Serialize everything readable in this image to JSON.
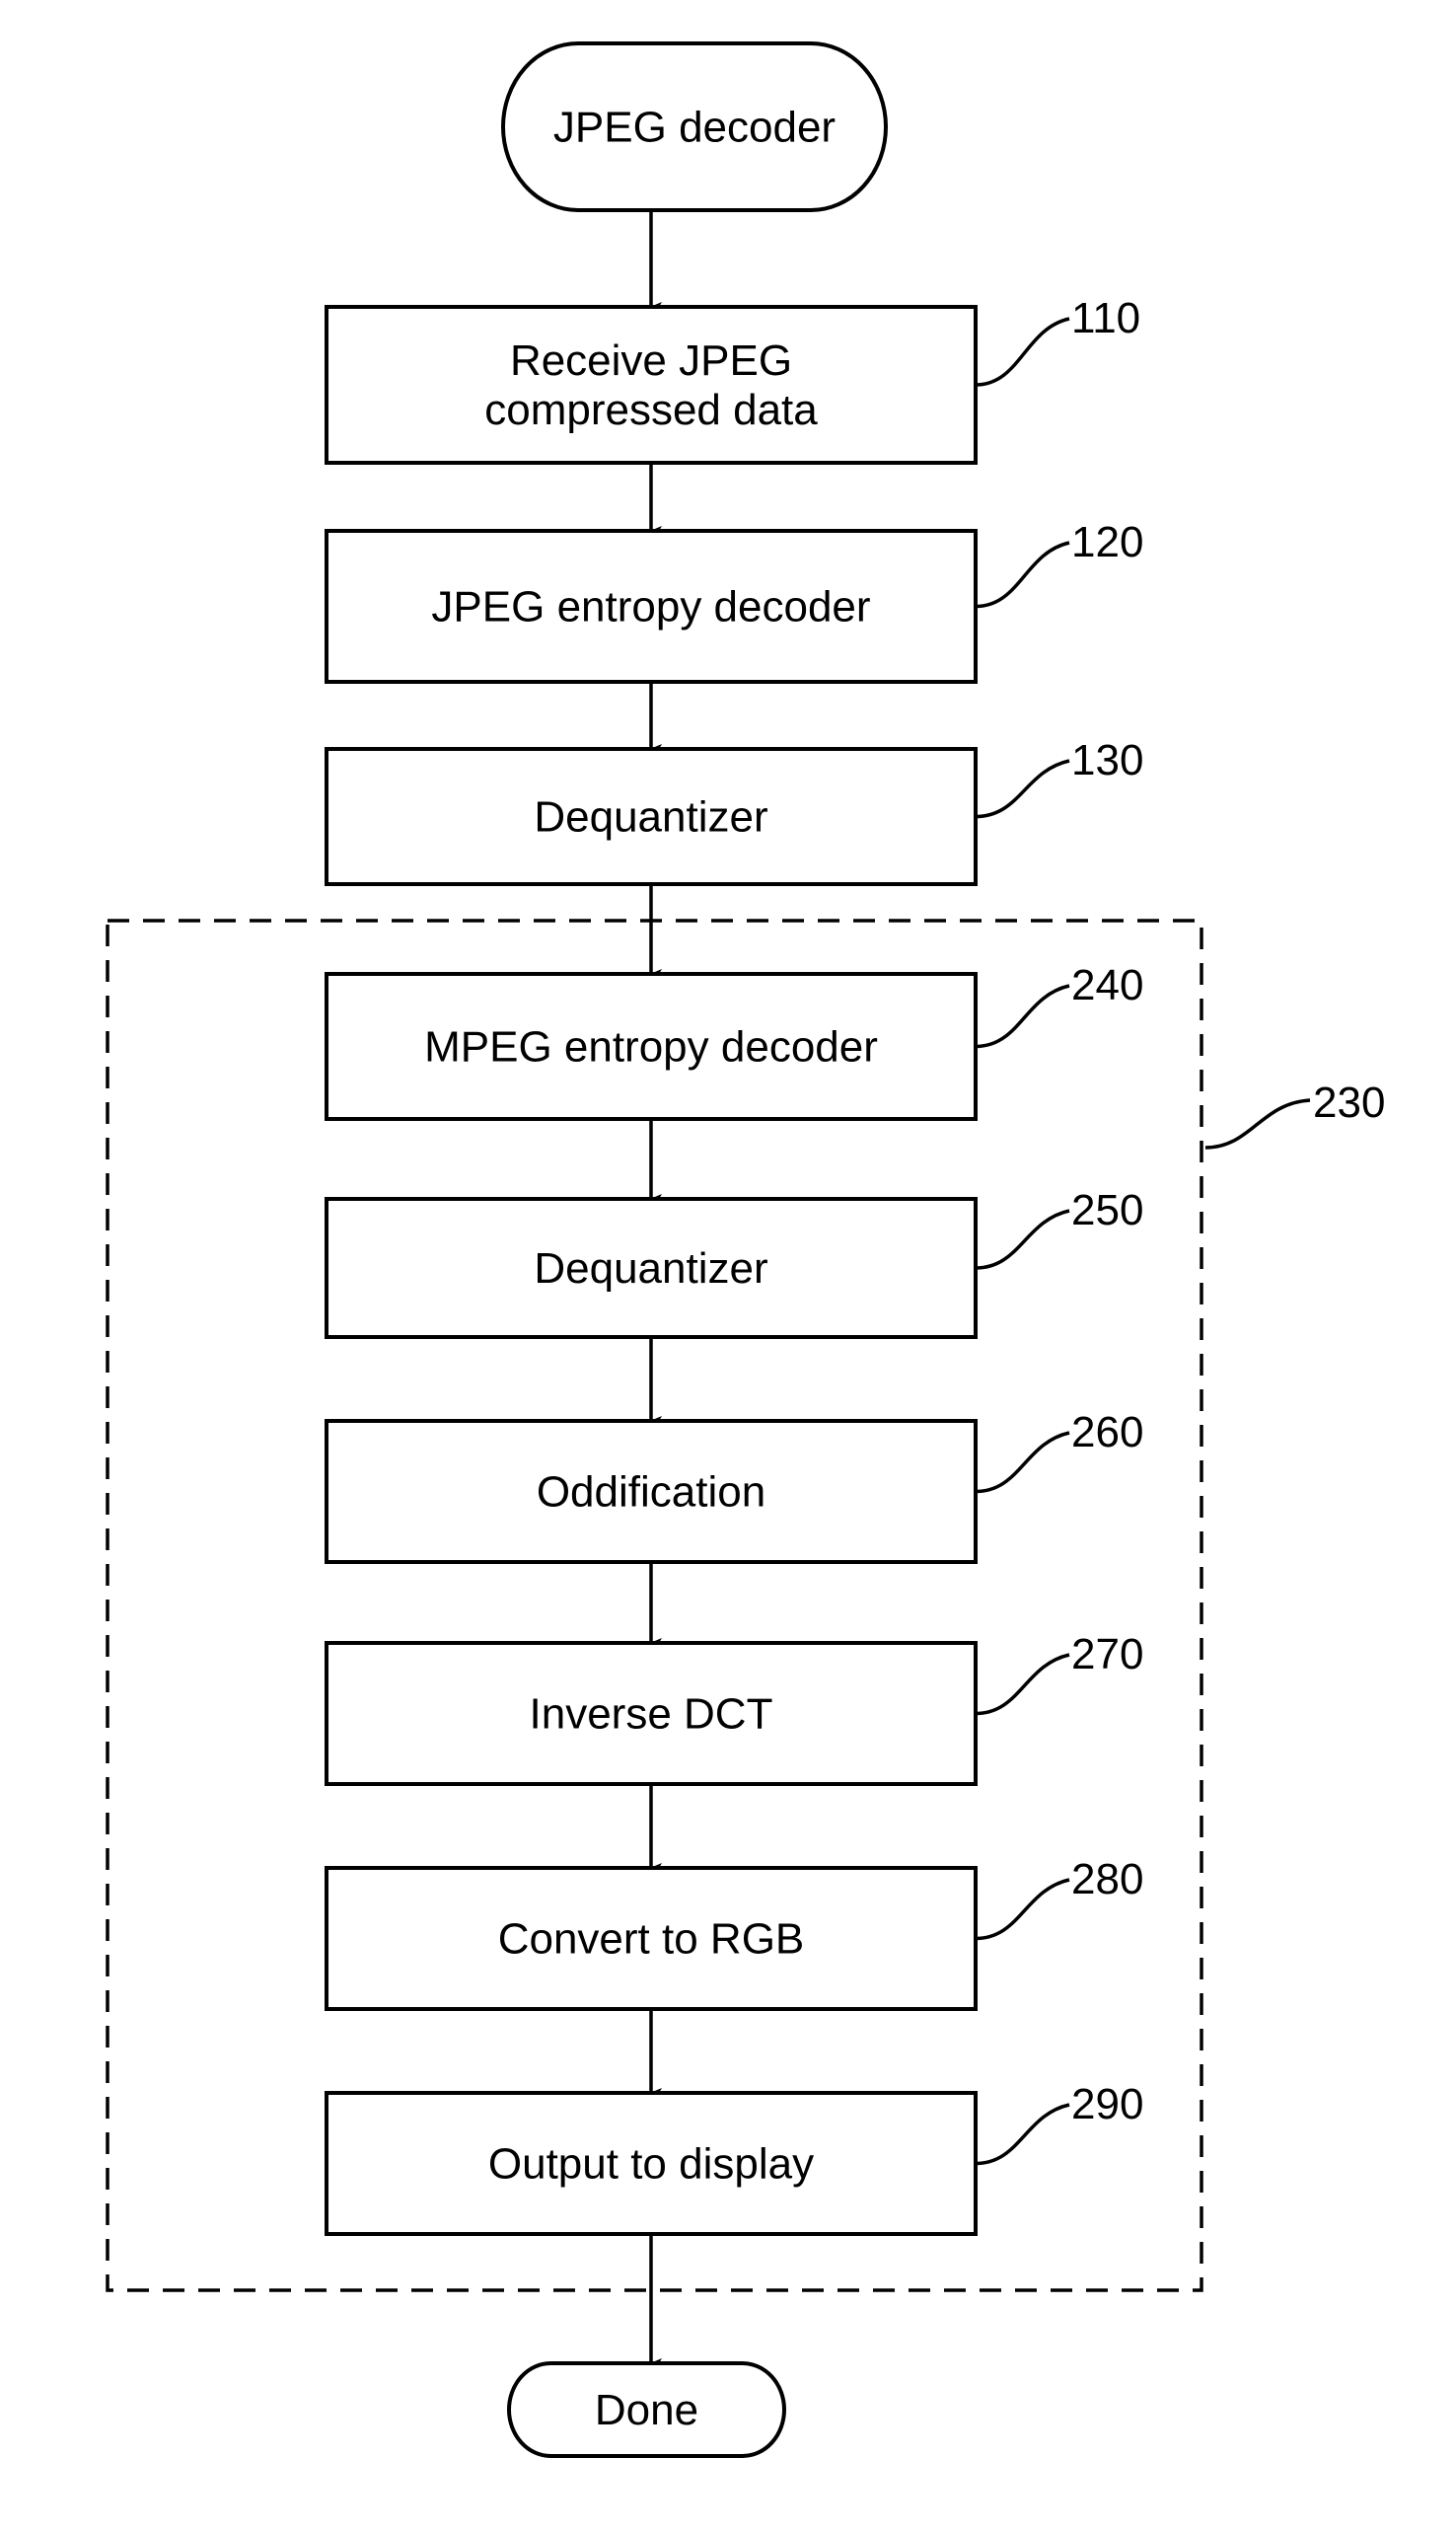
{
  "diagram": {
    "type": "flowchart",
    "start": {
      "label": "JPEG decoder"
    },
    "end": {
      "label": "Done"
    },
    "steps": [
      {
        "id": "110",
        "label": [
          "Receive JPEG",
          "compressed data"
        ],
        "ref": "110"
      },
      {
        "id": "120",
        "label": [
          "JPEG entropy decoder"
        ],
        "ref": "120"
      },
      {
        "id": "130",
        "label": [
          "Dequantizer"
        ],
        "ref": "130"
      },
      {
        "id": "240",
        "label": [
          "MPEG entropy decoder"
        ],
        "ref": "240"
      },
      {
        "id": "250",
        "label": [
          "Dequantizer"
        ],
        "ref": "250"
      },
      {
        "id": "260",
        "label": [
          "Oddification"
        ],
        "ref": "260"
      },
      {
        "id": "270",
        "label": [
          "Inverse DCT"
        ],
        "ref": "270"
      },
      {
        "id": "280",
        "label": [
          "Convert to RGB"
        ],
        "ref": "280"
      },
      {
        "id": "290",
        "label": [
          "Output to display"
        ],
        "ref": "290"
      }
    ],
    "group": {
      "ref": "230",
      "contains": [
        "240",
        "250",
        "260",
        "270",
        "280",
        "290"
      ]
    }
  }
}
